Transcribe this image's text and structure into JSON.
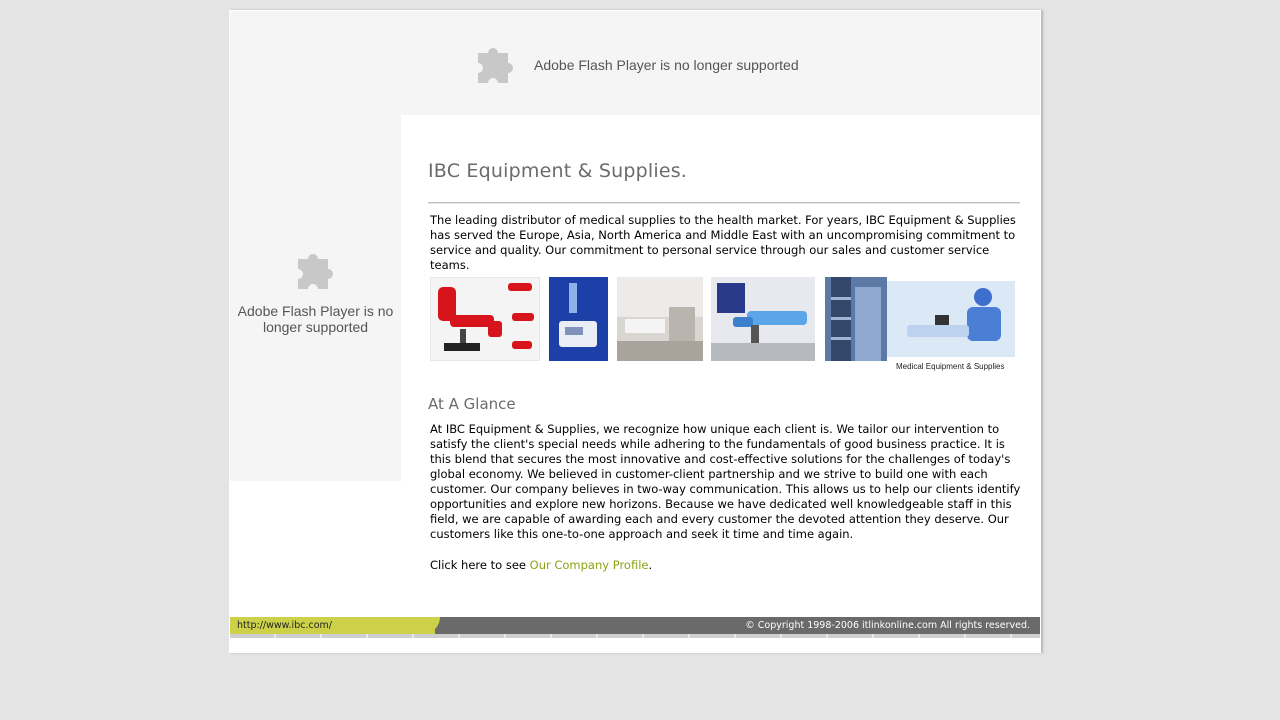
{
  "flash": {
    "top_message": "Adobe Flash Player is no longer supported",
    "side_message": "Adobe Flash Player is no longer supported",
    "icon": "puzzle-piece-icon"
  },
  "main": {
    "title": "IBC Equipment & Supplies.",
    "intro": "The leading distributor of medical supplies to the health market. For years, IBC Equipment & Supplies has served the Europe, Asia, North America and Middle East with an uncompromising commitment to service and quality. Our commitment to personal service through our sales and customer service teams.",
    "gallery_caption": "Medical Equipment & Supplies",
    "section_title": "At A Glance",
    "glance_text": "At IBC Equipment & Supplies, we recognize how unique each client is. We tailor our intervention to satisfy the client's special needs while adhering to the fundamentals of good business practice. It is this blend that secures the most innovative and cost-effective solutions for the challenges of today's global economy. We believed in customer-client partnership and we strive to build one with each customer. Our company believes in two-way communication. This allows us to help our clients identify opportunities and explore new horizons. Because we have dedicated well knowledgeable staff in this field, we are capable of awarding each and every customer the devoted attention they deserve. Our customers like this one-to-one approach and seek it time and time again.",
    "cta_prefix": "Click here to see ",
    "cta_link": "Our Company Profile",
    "cta_suffix": "."
  },
  "footer": {
    "url": "http://www.ibc.com/",
    "copyright": "© Copyright 1998-2006 itlinkonline.com All rights reserved."
  },
  "colors": {
    "accent_link": "#8fa214",
    "footer_bar": "#6a6a6a",
    "footer_accent": "#cdd14a"
  }
}
